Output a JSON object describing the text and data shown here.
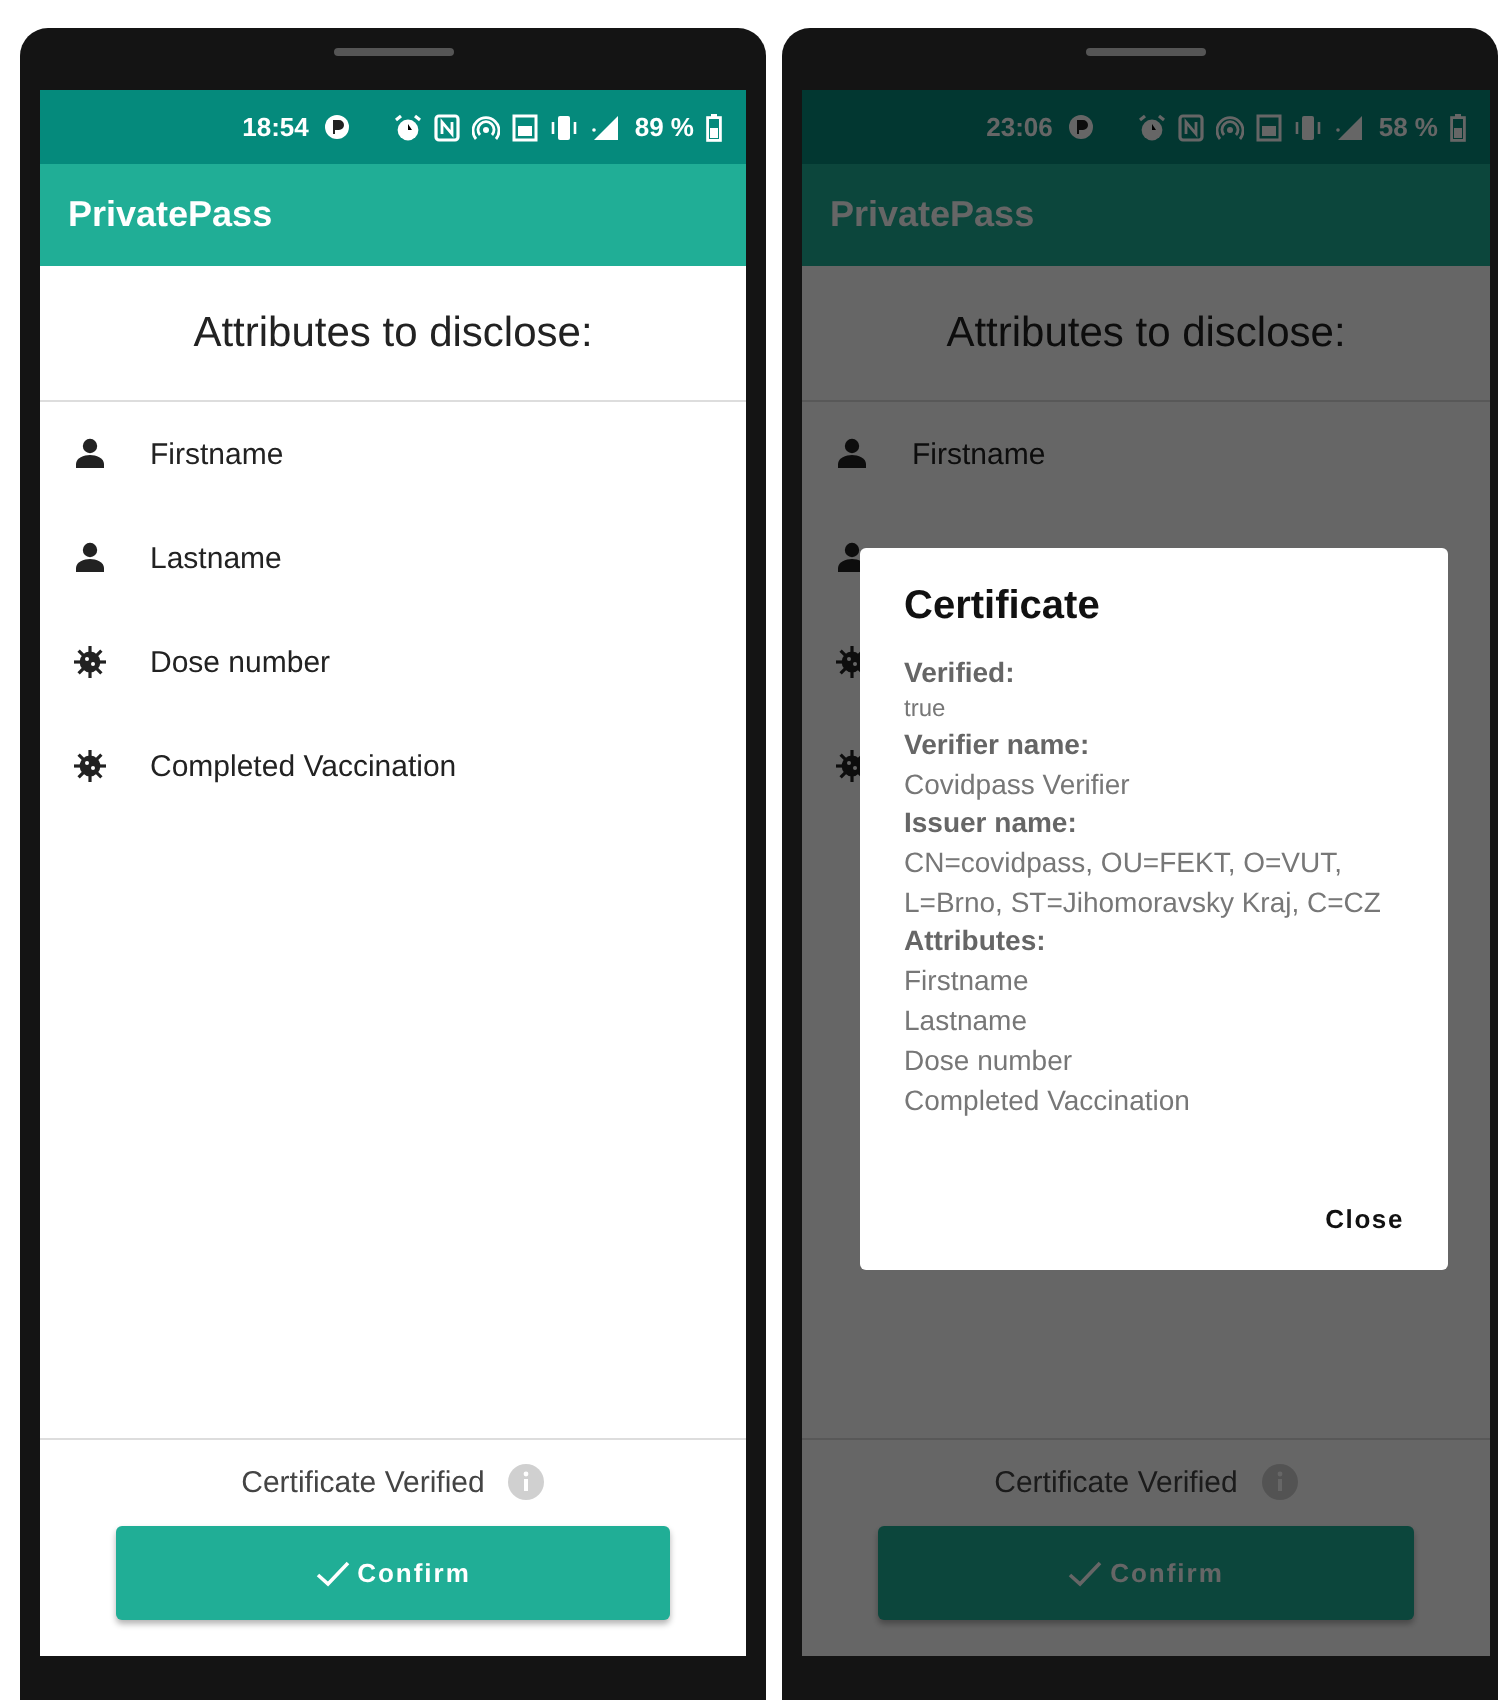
{
  "phones": [
    {
      "status_bar": {
        "time": "18:54",
        "battery": "89 %"
      },
      "app_bar": {
        "title": "PrivatePass"
      },
      "heading": "Attributes to disclose:",
      "attributes": [
        {
          "kind": "person",
          "label": "Firstname"
        },
        {
          "kind": "person",
          "label": "Lastname"
        },
        {
          "kind": "virus",
          "label": "Dose number"
        },
        {
          "kind": "virus",
          "label": "Completed Vaccination"
        }
      ],
      "footer": {
        "status": "Certificate Verified",
        "button": "Confirm"
      }
    },
    {
      "status_bar": {
        "time": "23:06",
        "battery": "58 %"
      },
      "app_bar": {
        "title": "PrivatePass"
      },
      "heading": "Attributes to disclose:",
      "attributes": [
        {
          "kind": "person",
          "label": "Firstname"
        },
        {
          "kind": "person"
        },
        {
          "kind": "virus"
        },
        {
          "kind": "virus"
        }
      ],
      "footer": {
        "status": "Certificate Verified",
        "button": "Confirm"
      },
      "dialog": {
        "title": "Certificate",
        "fields": [
          {
            "label": "Verified:",
            "kind": "flag",
            "values": [
              "true"
            ]
          },
          {
            "label": "Verifier name:",
            "kind": "text",
            "values": [
              "Covidpass Verifier"
            ]
          },
          {
            "label": "Issuer name:",
            "kind": "text",
            "values": [
              "CN=covidpass, OU=FEKT, O=VUT, L=Brno, ST=Jihomoravsky Kraj, C=CZ"
            ]
          },
          {
            "label": "Attributes:",
            "kind": "text",
            "values": [
              "Firstname",
              "Lastname",
              "Dose number",
              "Completed Vaccination"
            ]
          }
        ],
        "close": "Close"
      }
    }
  ]
}
